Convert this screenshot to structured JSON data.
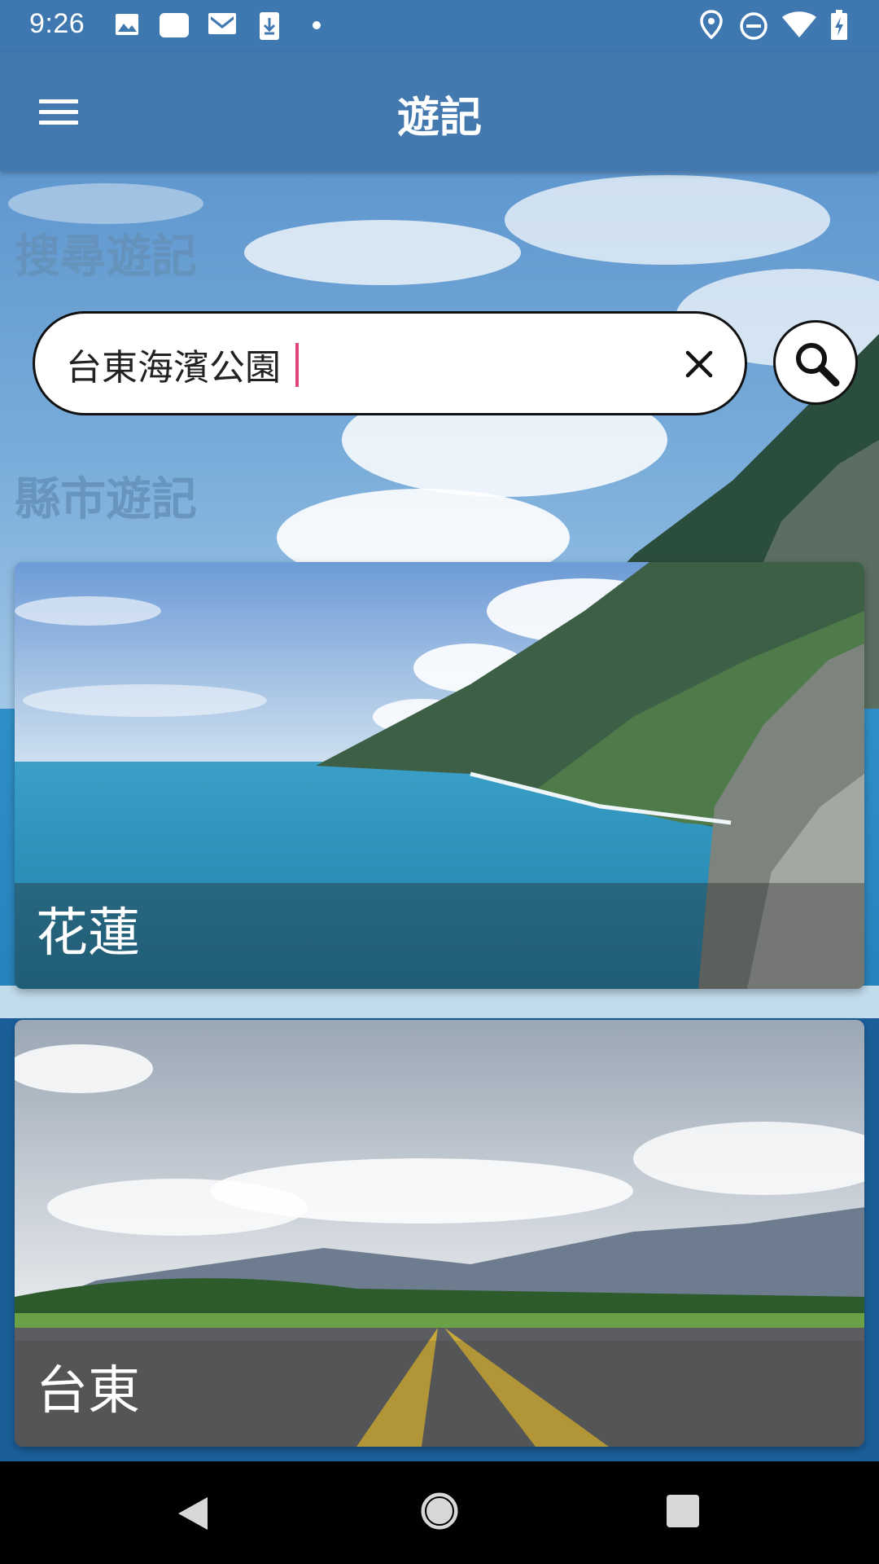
{
  "status_bar": {
    "time": "9:26",
    "left_icons": [
      "image-icon",
      "card-icon",
      "gmail-icon",
      "download-icon",
      "dot-icon"
    ],
    "right_icons": [
      "location-icon",
      "dnd-icon",
      "wifi-icon",
      "battery-icon"
    ]
  },
  "app_bar": {
    "title": "遊記",
    "menu_icon": "hamburger-menu-icon"
  },
  "search_section": {
    "heading": "搜尋遊記",
    "value": "台東海濱公園",
    "clear_icon": "close-icon",
    "search_icon": "search-icon"
  },
  "city_section": {
    "heading": "縣市遊記",
    "cards": [
      {
        "label": "花蓮"
      },
      {
        "label": "台東"
      }
    ]
  },
  "nav_bar": {
    "buttons": [
      "back-icon",
      "home-icon",
      "recents-icon"
    ]
  },
  "colors": {
    "app_bar": "#4479b0",
    "status_bar": "#3f78b0",
    "heading": "#6491b9",
    "caret": "#e0457b"
  }
}
